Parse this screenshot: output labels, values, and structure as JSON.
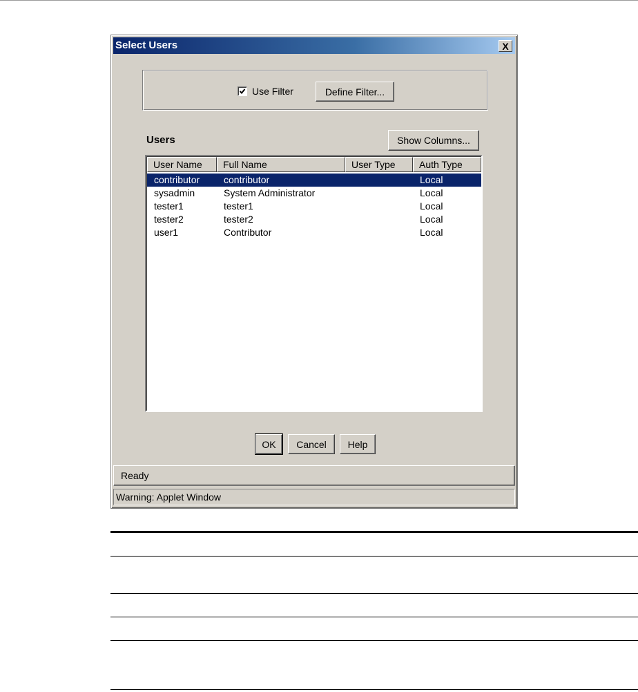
{
  "dialog": {
    "title": "Select Users",
    "close_glyph": "X",
    "filter": {
      "use_filter_label": "Use Filter",
      "use_filter_checked": true,
      "define_filter_label": "Define Filter..."
    },
    "users_heading": "Users",
    "show_columns_label": "Show Columns...",
    "table": {
      "columns": [
        "User Name",
        "Full Name",
        "User Type",
        "Auth Type"
      ],
      "rows": [
        {
          "user_name": "contributor",
          "full_name": "contributor",
          "user_type": "",
          "auth_type": "Local",
          "selected": true
        },
        {
          "user_name": "sysadmin",
          "full_name": "System Administrator",
          "user_type": "",
          "auth_type": "Local",
          "selected": false
        },
        {
          "user_name": "tester1",
          "full_name": "tester1",
          "user_type": "",
          "auth_type": "Local",
          "selected": false
        },
        {
          "user_name": "tester2",
          "full_name": "tester2",
          "user_type": "",
          "auth_type": "Local",
          "selected": false
        },
        {
          "user_name": "user1",
          "full_name": "Contributor",
          "user_type": "",
          "auth_type": "Local",
          "selected": false
        }
      ]
    },
    "buttons": {
      "ok": "OK",
      "cancel": "Cancel",
      "help": "Help"
    },
    "status": "Ready",
    "warning": "Warning: Applet Window"
  },
  "colors": {
    "dialog_bg": "#d4d0c8",
    "title_gradient_start": "#0a246a",
    "title_gradient_end": "#a6caf0",
    "selection": "#0a246a"
  },
  "icons": [
    "checkmark-icon",
    "close-icon"
  ]
}
